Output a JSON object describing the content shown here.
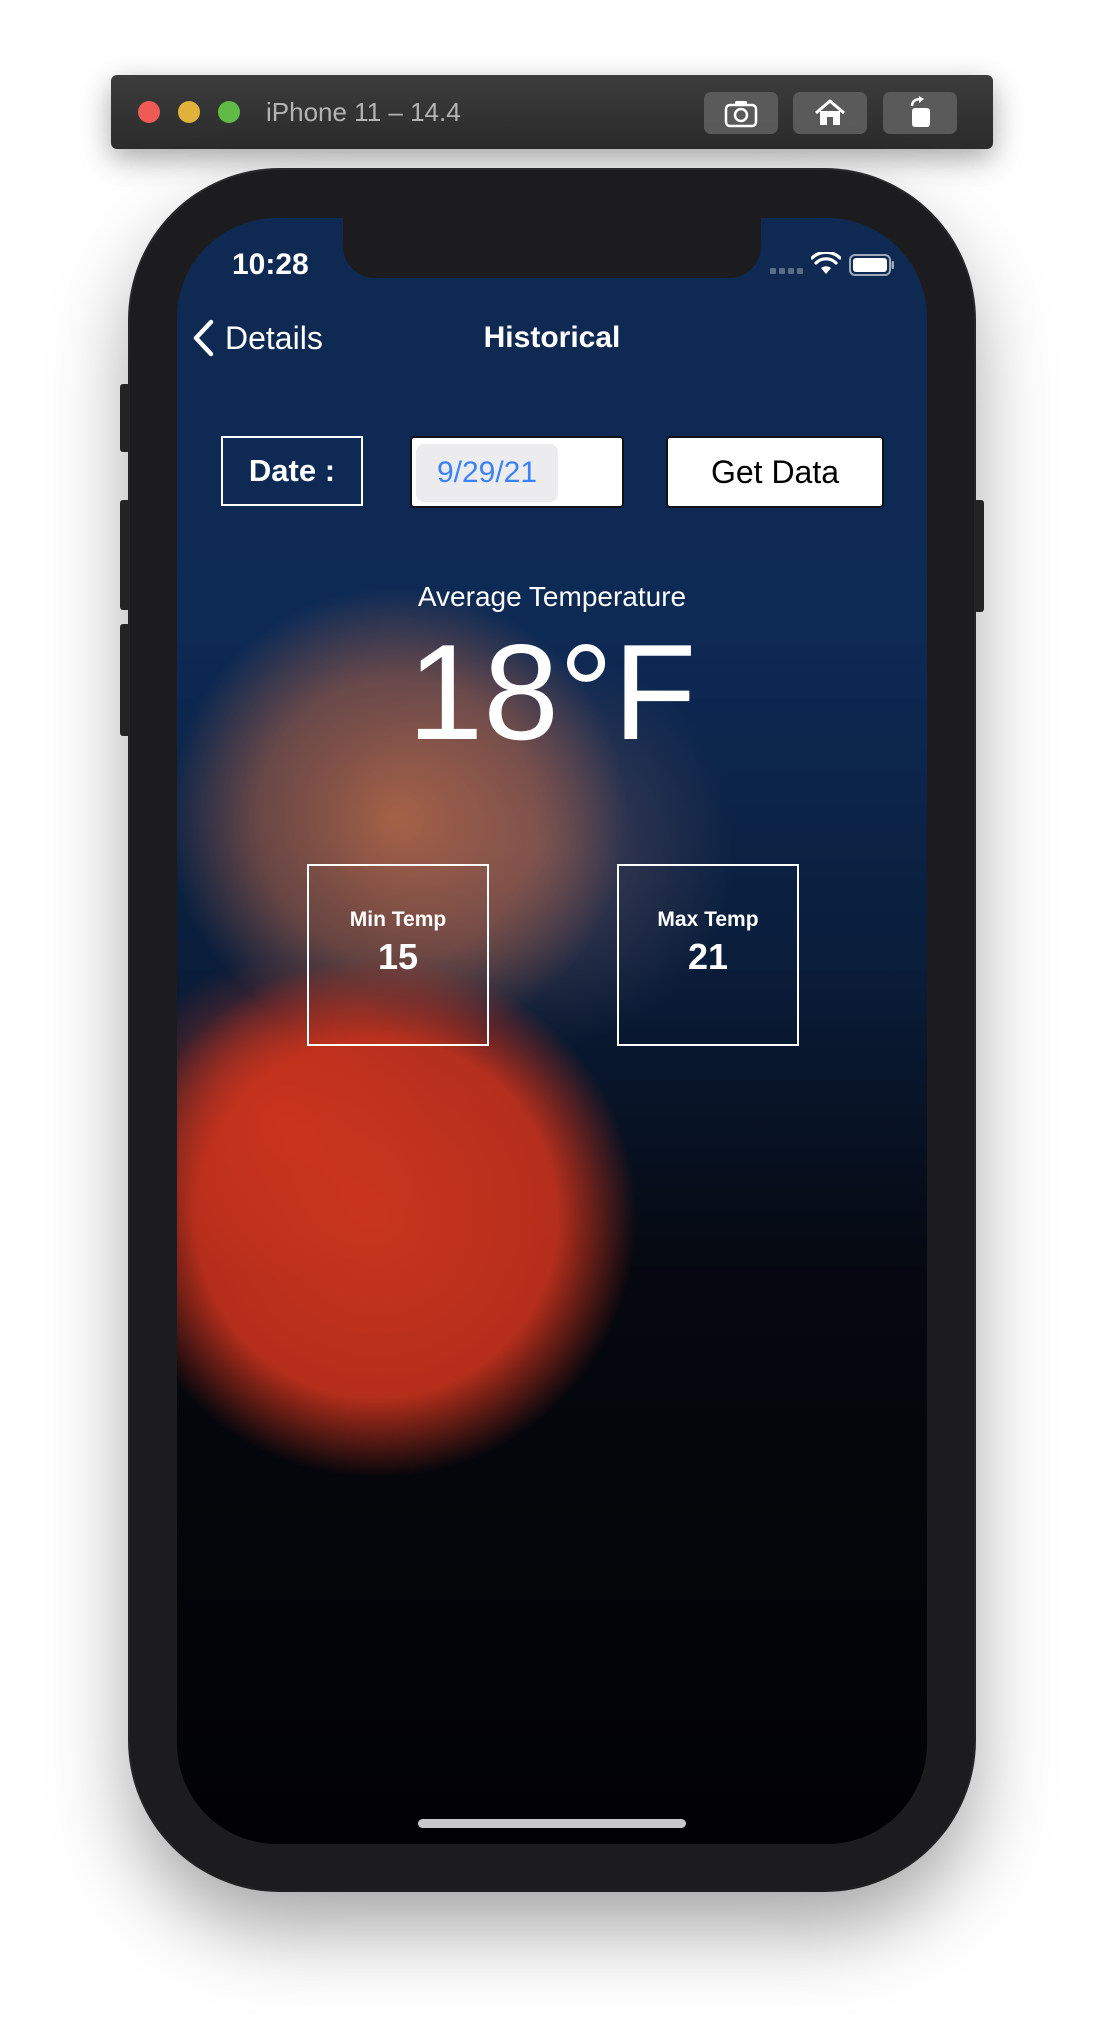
{
  "simulator": {
    "title": "iPhone 11 – 14.4",
    "buttons": [
      "screenshot-icon",
      "home-icon",
      "rotate-icon"
    ]
  },
  "status_bar": {
    "time": "10:28",
    "icons": [
      "cellular-signal-icon",
      "wifi-icon",
      "battery-icon"
    ]
  },
  "nav": {
    "back_label": "Details",
    "title": "Historical"
  },
  "form": {
    "date_label": "Date :",
    "date_value": "9/29/21",
    "get_data_label": "Get Data"
  },
  "weather": {
    "avg_label": "Average Temperature",
    "avg_value": "18°F",
    "min_label": "Min Temp",
    "min_value": "15",
    "max_label": "Max Temp",
    "max_value": "21"
  },
  "colors": {
    "accent": "#3a82f6",
    "background_top": "#0f2a52",
    "background_bottom": "#020204"
  }
}
